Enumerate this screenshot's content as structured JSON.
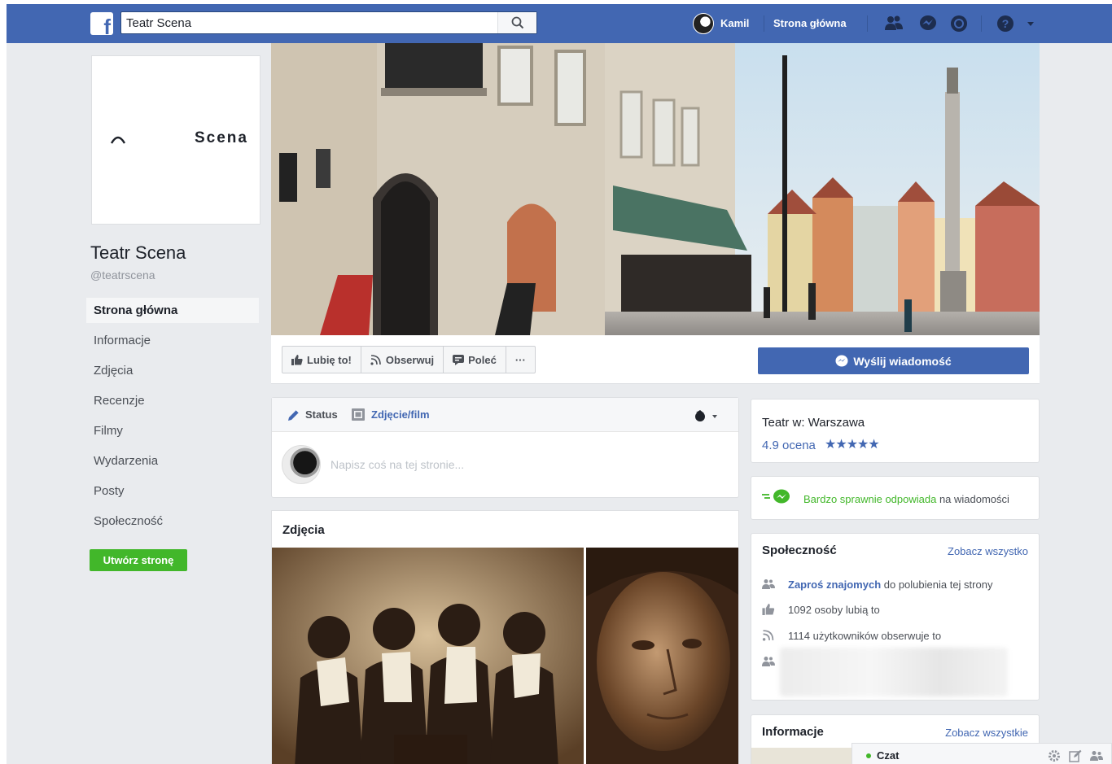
{
  "topbar": {
    "search_value": "Teatr Scena",
    "user_name": "Kamil",
    "home_label": "Strona główna"
  },
  "page": {
    "logo_text": "Scena",
    "name": "Teatr Scena",
    "handle": "@teatrscena"
  },
  "sidebar": {
    "items": [
      {
        "label": "Strona główna"
      },
      {
        "label": "Informacje"
      },
      {
        "label": "Zdjęcia"
      },
      {
        "label": "Recenzje"
      },
      {
        "label": "Filmy"
      },
      {
        "label": "Wydarzenia"
      },
      {
        "label": "Posty"
      },
      {
        "label": "Społeczność"
      }
    ],
    "create_label": "Utwórz stronę"
  },
  "actions": {
    "like": "Lubię to!",
    "follow": "Obserwuj",
    "share": "Poleć",
    "more": "···",
    "message": "Wyślij wiadomość"
  },
  "composer": {
    "status_tab": "Status",
    "photo_tab": "Zdjęcie/film",
    "placeholder": "Napisz coś na tej stronie..."
  },
  "photos": {
    "title": "Zdjęcia"
  },
  "about_card": {
    "category": "Teatr w: Warszawa",
    "rating": "4.9 ocena",
    "stars": "★★★★★"
  },
  "response_card": {
    "highlight": "Bardzo sprawnie odpowiada",
    "rest": " na wiadomości"
  },
  "community": {
    "title": "Społeczność",
    "see_all": "Zobacz wszystko",
    "invite_link": "Zaproś znajomych",
    "invite_rest": " do polubienia tej strony",
    "likes": "1092 osoby lubią to",
    "followers": "1114 użytkowników obserwuje to"
  },
  "info": {
    "title": "Informacje",
    "see_all": "Zobacz wszystkie"
  },
  "chat": {
    "label": "Czat"
  },
  "colors": {
    "brand": "#4267b2",
    "green": "#42b72a",
    "background": "#e9ebee"
  }
}
